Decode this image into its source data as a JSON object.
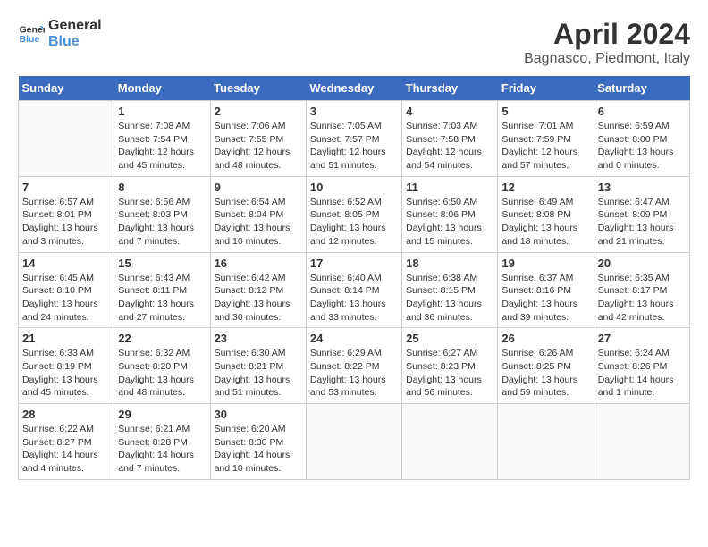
{
  "header": {
    "logo_line1": "General",
    "logo_line2": "Blue",
    "title": "April 2024",
    "subtitle": "Bagnasco, Piedmont, Italy"
  },
  "calendar": {
    "weekdays": [
      "Sunday",
      "Monday",
      "Tuesday",
      "Wednesday",
      "Thursday",
      "Friday",
      "Saturday"
    ],
    "weeks": [
      [
        {
          "day": "",
          "info": ""
        },
        {
          "day": "1",
          "info": "Sunrise: 7:08 AM\nSunset: 7:54 PM\nDaylight: 12 hours\nand 45 minutes."
        },
        {
          "day": "2",
          "info": "Sunrise: 7:06 AM\nSunset: 7:55 PM\nDaylight: 12 hours\nand 48 minutes."
        },
        {
          "day": "3",
          "info": "Sunrise: 7:05 AM\nSunset: 7:57 PM\nDaylight: 12 hours\nand 51 minutes."
        },
        {
          "day": "4",
          "info": "Sunrise: 7:03 AM\nSunset: 7:58 PM\nDaylight: 12 hours\nand 54 minutes."
        },
        {
          "day": "5",
          "info": "Sunrise: 7:01 AM\nSunset: 7:59 PM\nDaylight: 12 hours\nand 57 minutes."
        },
        {
          "day": "6",
          "info": "Sunrise: 6:59 AM\nSunset: 8:00 PM\nDaylight: 13 hours\nand 0 minutes."
        }
      ],
      [
        {
          "day": "7",
          "info": "Sunrise: 6:57 AM\nSunset: 8:01 PM\nDaylight: 13 hours\nand 3 minutes."
        },
        {
          "day": "8",
          "info": "Sunrise: 6:56 AM\nSunset: 8:03 PM\nDaylight: 13 hours\nand 7 minutes."
        },
        {
          "day": "9",
          "info": "Sunrise: 6:54 AM\nSunset: 8:04 PM\nDaylight: 13 hours\nand 10 minutes."
        },
        {
          "day": "10",
          "info": "Sunrise: 6:52 AM\nSunset: 8:05 PM\nDaylight: 13 hours\nand 12 minutes."
        },
        {
          "day": "11",
          "info": "Sunrise: 6:50 AM\nSunset: 8:06 PM\nDaylight: 13 hours\nand 15 minutes."
        },
        {
          "day": "12",
          "info": "Sunrise: 6:49 AM\nSunset: 8:08 PM\nDaylight: 13 hours\nand 18 minutes."
        },
        {
          "day": "13",
          "info": "Sunrise: 6:47 AM\nSunset: 8:09 PM\nDaylight: 13 hours\nand 21 minutes."
        }
      ],
      [
        {
          "day": "14",
          "info": "Sunrise: 6:45 AM\nSunset: 8:10 PM\nDaylight: 13 hours\nand 24 minutes."
        },
        {
          "day": "15",
          "info": "Sunrise: 6:43 AM\nSunset: 8:11 PM\nDaylight: 13 hours\nand 27 minutes."
        },
        {
          "day": "16",
          "info": "Sunrise: 6:42 AM\nSunset: 8:12 PM\nDaylight: 13 hours\nand 30 minutes."
        },
        {
          "day": "17",
          "info": "Sunrise: 6:40 AM\nSunset: 8:14 PM\nDaylight: 13 hours\nand 33 minutes."
        },
        {
          "day": "18",
          "info": "Sunrise: 6:38 AM\nSunset: 8:15 PM\nDaylight: 13 hours\nand 36 minutes."
        },
        {
          "day": "19",
          "info": "Sunrise: 6:37 AM\nSunset: 8:16 PM\nDaylight: 13 hours\nand 39 minutes."
        },
        {
          "day": "20",
          "info": "Sunrise: 6:35 AM\nSunset: 8:17 PM\nDaylight: 13 hours\nand 42 minutes."
        }
      ],
      [
        {
          "day": "21",
          "info": "Sunrise: 6:33 AM\nSunset: 8:19 PM\nDaylight: 13 hours\nand 45 minutes."
        },
        {
          "day": "22",
          "info": "Sunrise: 6:32 AM\nSunset: 8:20 PM\nDaylight: 13 hours\nand 48 minutes."
        },
        {
          "day": "23",
          "info": "Sunrise: 6:30 AM\nSunset: 8:21 PM\nDaylight: 13 hours\nand 51 minutes."
        },
        {
          "day": "24",
          "info": "Sunrise: 6:29 AM\nSunset: 8:22 PM\nDaylight: 13 hours\nand 53 minutes."
        },
        {
          "day": "25",
          "info": "Sunrise: 6:27 AM\nSunset: 8:23 PM\nDaylight: 13 hours\nand 56 minutes."
        },
        {
          "day": "26",
          "info": "Sunrise: 6:26 AM\nSunset: 8:25 PM\nDaylight: 13 hours\nand 59 minutes."
        },
        {
          "day": "27",
          "info": "Sunrise: 6:24 AM\nSunset: 8:26 PM\nDaylight: 14 hours\nand 1 minute."
        }
      ],
      [
        {
          "day": "28",
          "info": "Sunrise: 6:22 AM\nSunset: 8:27 PM\nDaylight: 14 hours\nand 4 minutes."
        },
        {
          "day": "29",
          "info": "Sunrise: 6:21 AM\nSunset: 8:28 PM\nDaylight: 14 hours\nand 7 minutes."
        },
        {
          "day": "30",
          "info": "Sunrise: 6:20 AM\nSunset: 8:30 PM\nDaylight: 14 hours\nand 10 minutes."
        },
        {
          "day": "",
          "info": ""
        },
        {
          "day": "",
          "info": ""
        },
        {
          "day": "",
          "info": ""
        },
        {
          "day": "",
          "info": ""
        }
      ]
    ]
  }
}
